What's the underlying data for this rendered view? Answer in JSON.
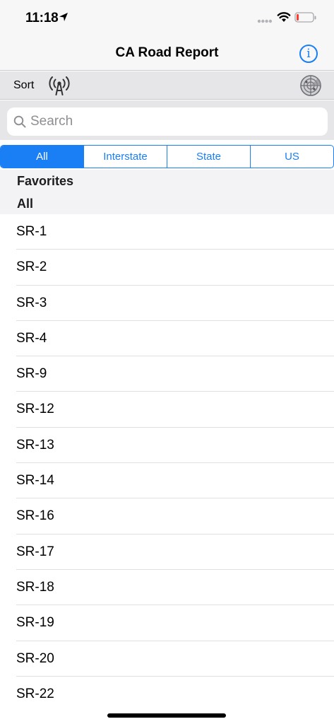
{
  "status_bar": {
    "time": "11:18",
    "icons": [
      "location-arrow-icon",
      "signal-dots-icon",
      "wifi-icon",
      "battery-low-icon"
    ]
  },
  "nav_bar": {
    "title": "CA Road Report",
    "info_icon": "info-circle-icon",
    "info_glyph": "i"
  },
  "toolbar": {
    "sort_label": "Sort",
    "antenna_icon": "antenna-signal-icon",
    "radar_icon": "radar-icon"
  },
  "search": {
    "placeholder": "Search",
    "value": ""
  },
  "filter_tabs": [
    {
      "label": "All",
      "selected": true
    },
    {
      "label": "Interstate",
      "selected": false
    },
    {
      "label": "State",
      "selected": false
    },
    {
      "label": "US",
      "selected": false
    }
  ],
  "sections": {
    "favorites": "Favorites",
    "all": "All"
  },
  "roads": [
    "SR-1",
    "SR-2",
    "SR-3",
    "SR-4",
    "SR-9",
    "SR-12",
    "SR-13",
    "SR-14",
    "SR-16",
    "SR-17",
    "SR-18",
    "SR-19",
    "SR-20",
    "SR-22"
  ],
  "colors": {
    "accent": "#1a7ef5",
    "battery_low": "#ff3b30",
    "bar_background": "#f7f7f7",
    "toolbar_background": "#e6e6e9"
  }
}
